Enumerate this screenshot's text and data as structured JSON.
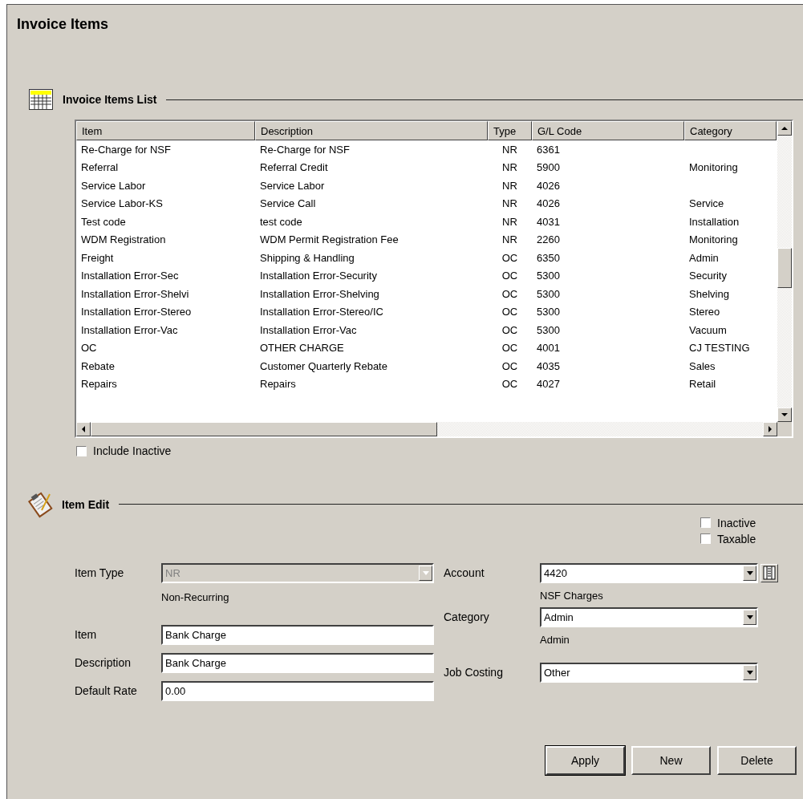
{
  "title": "Invoice Items",
  "list_section": {
    "title": "Invoice Items List",
    "columns": [
      "Item",
      "Description",
      "Type",
      "G/L Code",
      "Category"
    ],
    "rows": [
      [
        "Re-Charge for NSF",
        "Re-Charge for NSF",
        "NR",
        "6361",
        ""
      ],
      [
        "Referral",
        "Referral Credit",
        "NR",
        "5900",
        "Monitoring"
      ],
      [
        "Service Labor",
        "Service Labor",
        "NR",
        "4026",
        ""
      ],
      [
        "Service Labor-KS",
        "Service Call",
        "NR",
        "4026",
        "Service"
      ],
      [
        "Test code",
        "test code",
        "NR",
        "4031",
        "Installation"
      ],
      [
        "WDM Registration",
        "WDM Permit Registration Fee",
        "NR",
        "2260",
        "Monitoring"
      ],
      [
        "Freight",
        "Shipping & Handling",
        "OC",
        "6350",
        "Admin"
      ],
      [
        "Installation Error-Sec",
        "Installation Error-Security",
        "OC",
        "5300",
        "Security"
      ],
      [
        "Installation Error-Shelvi",
        "Installation Error-Shelving",
        "OC",
        "5300",
        "Shelving"
      ],
      [
        "Installation Error-Stereo",
        "Installation Error-Stereo/IC",
        "OC",
        "5300",
        "Stereo"
      ],
      [
        "Installation Error-Vac",
        "Installation Error-Vac",
        "OC",
        "5300",
        "Vacuum"
      ],
      [
        "OC",
        "OTHER CHARGE",
        "OC",
        "4001",
        "CJ TESTING"
      ],
      [
        "Rebate",
        "Customer Quarterly Rebate",
        "OC",
        "4035",
        "Sales"
      ],
      [
        "Repairs",
        "Repairs",
        "OC",
        "4027",
        "Retail"
      ]
    ],
    "include_inactive": {
      "label": "Include Inactive",
      "checked": false
    }
  },
  "edit_section": {
    "title": "Item Edit",
    "flags": [
      {
        "label": "Inactive",
        "checked": false
      },
      {
        "label": "Taxable",
        "checked": false
      }
    ],
    "item_type": {
      "label": "Item Type",
      "value": "NR",
      "disabled": true,
      "note": "Non-Recurring"
    },
    "item": {
      "label": "Item",
      "value": "Bank Charge"
    },
    "description": {
      "label": "Description",
      "value": "Bank Charge"
    },
    "default_rate": {
      "label": "Default Rate",
      "value": "0.00"
    },
    "account": {
      "label": "Account",
      "value": "4420",
      "disabled": false,
      "note": "NSF Charges"
    },
    "category": {
      "label": "Category",
      "value": "Admin",
      "disabled": false,
      "note": "Admin"
    },
    "job_costing": {
      "label": "Job Costing",
      "value": "Other",
      "disabled": false
    }
  },
  "buttons": [
    {
      "label": "Apply",
      "default": true
    },
    {
      "label": "New",
      "default": false
    },
    {
      "label": "Delete",
      "default": false
    }
  ]
}
